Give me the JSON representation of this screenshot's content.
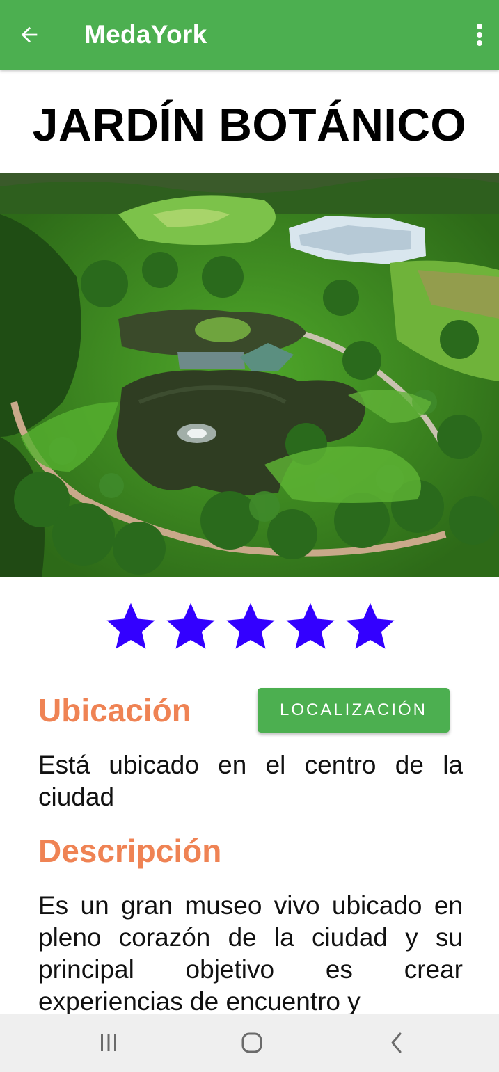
{
  "app_bar": {
    "title": "MedaYork",
    "background_color": "#4caf50",
    "back_icon": "arrow-back-icon",
    "menu_icon": "more-vert-icon"
  },
  "heading": "JARDÍN BOTÁNICO",
  "photo": {
    "subject": "aerial-park-photo"
  },
  "rating": {
    "stars": 5,
    "max": 5,
    "color": "#3300ff"
  },
  "location": {
    "title": "Ubicación",
    "button_label": "LOCALIZACIÓN",
    "text": "Está ubicado en el centro de la ciudad"
  },
  "description": {
    "title": "Descripción",
    "text": "Es un gran museo vivo ubicado en pleno corazón de la ciudad y su principal objetivo es crear experiencias de encuentro y"
  },
  "accent_color": "#ef8354",
  "nav_bar": {
    "recents_icon": "recents-icon",
    "home_icon": "home-icon",
    "back_icon": "nav-back-icon"
  }
}
